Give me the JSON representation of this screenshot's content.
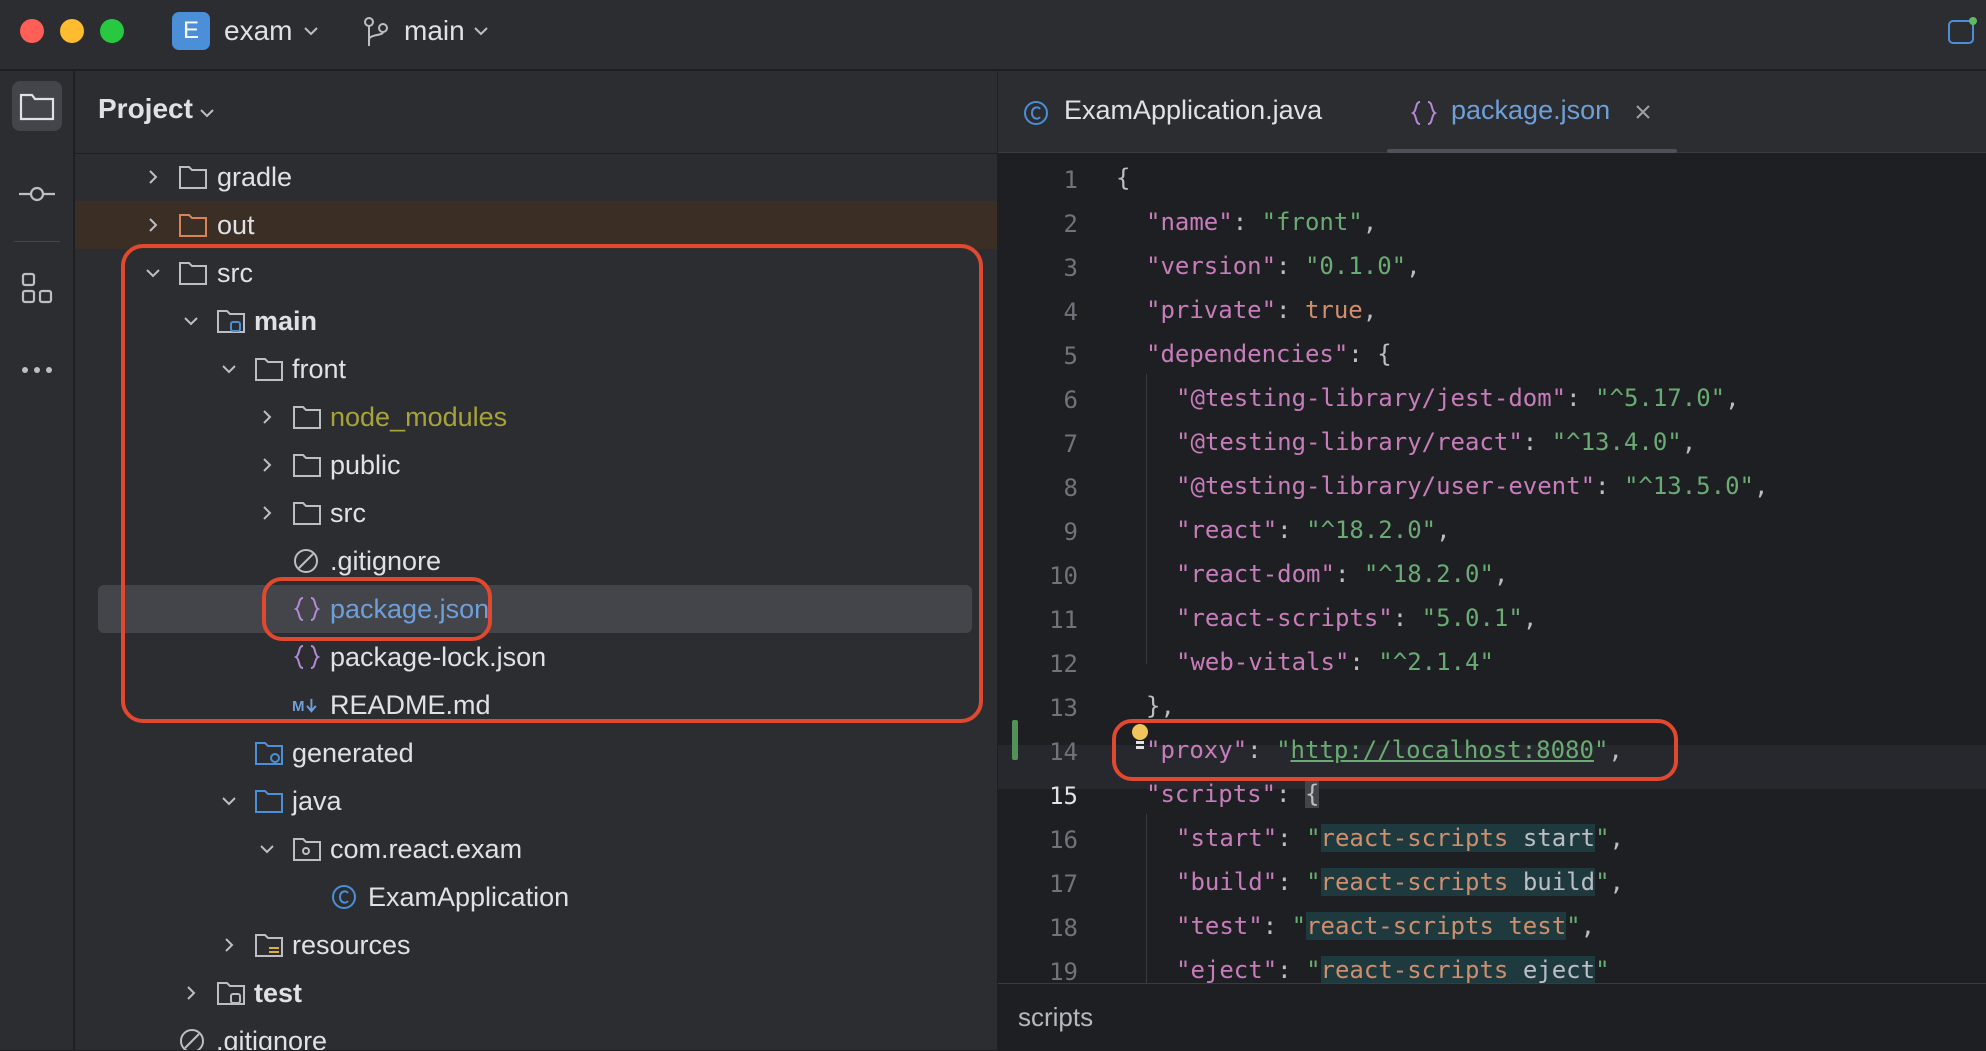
{
  "titlebar": {
    "project_badge": "E",
    "project_name": "exam",
    "branch": "main"
  },
  "project_panel": {
    "title": "Project",
    "rows": [
      {
        "label": "gradle",
        "kind": "folder",
        "color": "#dfe1e5"
      },
      {
        "label": "out",
        "kind": "folder",
        "color": "#dfe1e5"
      },
      {
        "label": "src",
        "kind": "folder"
      },
      {
        "label": "main",
        "kind": "module-folder",
        "bold": true
      },
      {
        "label": "front",
        "kind": "folder"
      },
      {
        "label": "node_modules",
        "kind": "folder",
        "color": "#a7a33a"
      },
      {
        "label": "public",
        "kind": "folder"
      },
      {
        "label": "src",
        "kind": "folder"
      },
      {
        "label": ".gitignore",
        "kind": "ignore-file"
      },
      {
        "label": "package.json",
        "kind": "json-file",
        "color": "#6f9fd8"
      },
      {
        "label": "package-lock.json",
        "kind": "json-file"
      },
      {
        "label": "README.md",
        "kind": "markdown-file"
      },
      {
        "label": "generated",
        "kind": "generated-folder"
      },
      {
        "label": "java",
        "kind": "source-folder"
      },
      {
        "label": "com.react.exam",
        "kind": "package-folder"
      },
      {
        "label": "ExamApplication",
        "kind": "class-file"
      },
      {
        "label": "resources",
        "kind": "resources-folder"
      },
      {
        "label": "test",
        "kind": "module-folder",
        "bold": true
      },
      {
        "label": ".gitignore",
        "kind": "ignore-file"
      }
    ]
  },
  "editor": {
    "tabs": [
      {
        "label": "ExamApplication.java",
        "active": false
      },
      {
        "label": "package.json",
        "active": true
      }
    ],
    "line_numbers": [
      "1",
      "2",
      "3",
      "4",
      "5",
      "6",
      "7",
      "8",
      "9",
      "10",
      "11",
      "12",
      "13",
      "14",
      "15",
      "16",
      "17",
      "18",
      "19"
    ],
    "active_line": "15",
    "breadcrumb": "scripts",
    "code": {
      "l1": "{",
      "name_key": "\"name\"",
      "name_val": "\"front\"",
      "version_key": "\"version\"",
      "version_val": "\"0.1.0\"",
      "private_key": "\"private\"",
      "private_val": "true",
      "deps_key": "\"dependencies\"",
      "d1_key": "\"@testing-library/jest-dom\"",
      "d1_val": "\"^5.17.0\"",
      "d2_key": "\"@testing-library/react\"",
      "d2_val": "\"^13.4.0\"",
      "d3_key": "\"@testing-library/user-event\"",
      "d3_val": "\"^13.5.0\"",
      "d4_key": "\"react\"",
      "d4_val": "\"^18.2.0\"",
      "d5_key": "\"react-dom\"",
      "d5_val": "\"^18.2.0\"",
      "d6_key": "\"react-scripts\"",
      "d6_val": "\"5.0.1\"",
      "d7_key": "\"web-vitals\"",
      "d7_val": "\"^2.1.4\"",
      "close_deps": "},",
      "proxy_key": "\"proxy\"",
      "proxy_url": "http://localhost:8080",
      "scripts_key": "\"scripts\"",
      "start_key": "\"start\"",
      "start_cmd": "react-scripts",
      "start_arg": "start",
      "build_key": "\"build\"",
      "build_cmd": "react-scripts",
      "build_arg": "build",
      "test_key": "\"test\"",
      "test_cmd": "react-scripts test",
      "eject_key": "\"eject\"",
      "eject_cmd": "react-scripts",
      "eject_arg": "eject"
    }
  },
  "colors": {
    "highlight_box": "#e0492f",
    "json_key": "#c77dbb",
    "json_string": "#6aab73",
    "json_keyword": "#cf8e6d",
    "selected_file": "#6f9fd8"
  }
}
